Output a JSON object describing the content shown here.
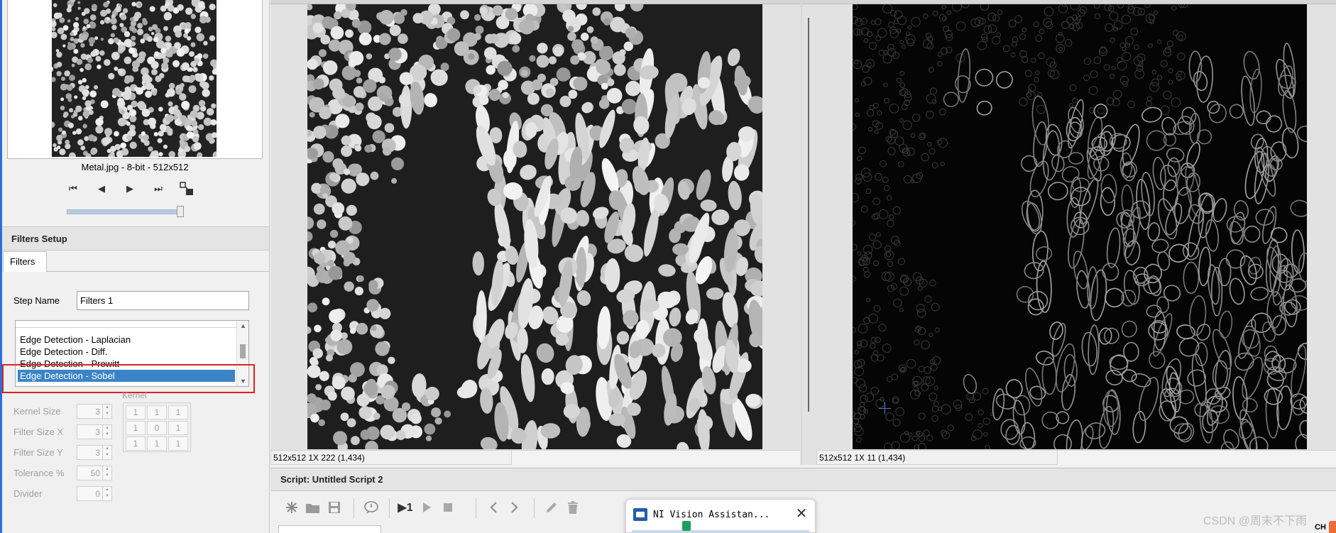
{
  "image_caption": "Metal.jpg - 8-bit - 512x512",
  "navigation": {
    "first": "⏮",
    "prev": "◀",
    "next": "▶",
    "last": "⏭",
    "slider_fraction": 0.97
  },
  "filters_setup": {
    "title": "Filters Setup",
    "tab": "Filters",
    "step_name_label": "Step Name",
    "step_name_value": "Filters 1",
    "filter_list": [
      "Edge Detection - Laplacian",
      "Edge Detection - Diff.",
      "Edge Detection - Prewitt",
      "Edge Detection - Sobel"
    ],
    "selected_index": 3,
    "kernel_caption": "Kernel",
    "params": [
      {
        "label": "Kernel Size",
        "value": "3"
      },
      {
        "label": "Filter Size X",
        "value": "3"
      },
      {
        "label": "Filter Size Y",
        "value": "3"
      },
      {
        "label": "Tolerance %",
        "value": "50"
      },
      {
        "label": "Divider",
        "value": "0"
      }
    ],
    "kernel": [
      "1",
      "1",
      "1",
      "1",
      "0",
      "1",
      "1",
      "1",
      "1"
    ]
  },
  "status": {
    "left": "512x512 1X 222    (1,434)",
    "right": "512x512 1X 11   (1,434)"
  },
  "script": {
    "title": "Script: Untitled Script 2",
    "run_once_label": "▶1"
  },
  "popup": {
    "title": "NI Vision Assistan...",
    "close": "✕"
  },
  "watermark": "CSDN @周末不下雨",
  "ime": "CH",
  "colors": {
    "selection": "#3b84c7",
    "highlight_box": "#e02020",
    "accent_edge": "#2a6edb"
  }
}
